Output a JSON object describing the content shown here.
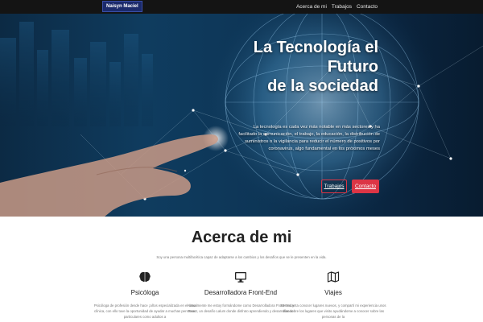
{
  "nav": {
    "brand": "Naisyn Maciel",
    "links": [
      "Acerca de mi",
      "Trabajos",
      "Contacto"
    ]
  },
  "hero": {
    "title_line1": "La Tecnología el",
    "title_line2": "Futuro",
    "title_line3": "de la sociedad",
    "text": "La tecnología es cada vez más notable en más sectores y ha facilitado la comunicación, el trabajo, la educación, la distribución de suministros o la vigilancia para reducir el número de positivos por coronavirus, algo fundamental en los próximos meses",
    "button_works": "Trabajos",
    "button_contact": "Contacto"
  },
  "about": {
    "title": "Acerca de mi",
    "subtitle": "Soy una persona multifacética capaz de adaptarse a los cambios y los desafíos que se le presenten en la vida.",
    "features": [
      {
        "icon": "brain-icon",
        "title": "Psicóloga",
        "text": "Psicóloga de profesión desde hace ¡años especializada en el área clínica, con ello tuve la oportunidad de ayudar a muchas personas particulares como adultos a"
      },
      {
        "icon": "monitor-icon",
        "title": "Desarrolladora Front-End",
        "text": "Actualmente me estoy formándome como Desarrolladora Front-End y React, un desafío Lalum donde disfruto aprendiendo y desarrollando"
      },
      {
        "icon": "map-icon",
        "title": "Viajes",
        "text": "Me encanta conocer lugares nuevos, y compartí mi experiencia unos días sobre los lugares que visito ayudándome a conocer sobre las personas de la"
      }
    ]
  },
  "colors": {
    "nav_bg": "#141414",
    "accent": "#dc3545",
    "brand_bg": "#1b2a6b"
  }
}
